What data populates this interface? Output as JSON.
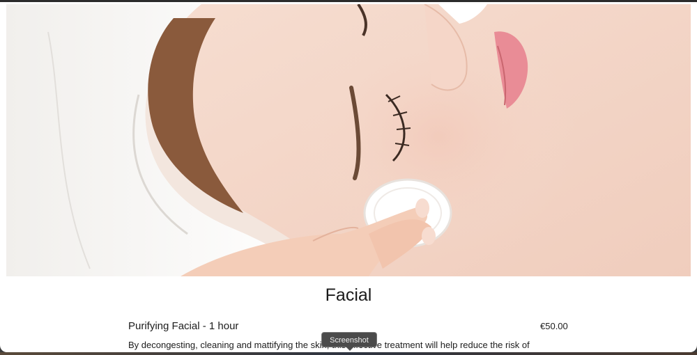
{
  "hero": {
    "image_alt": "Woman with towel on head receiving facial cleansing with cotton pad"
  },
  "section": {
    "title": "Facial"
  },
  "services": [
    {
      "name": "Purifying Facial - 1 hour",
      "price": "€50.00",
      "description": "By decongesting, cleaning and mattifying the skin, this effective treatment will help reduce the risk of"
    }
  ],
  "tooltip": {
    "label": "Screenshot"
  }
}
